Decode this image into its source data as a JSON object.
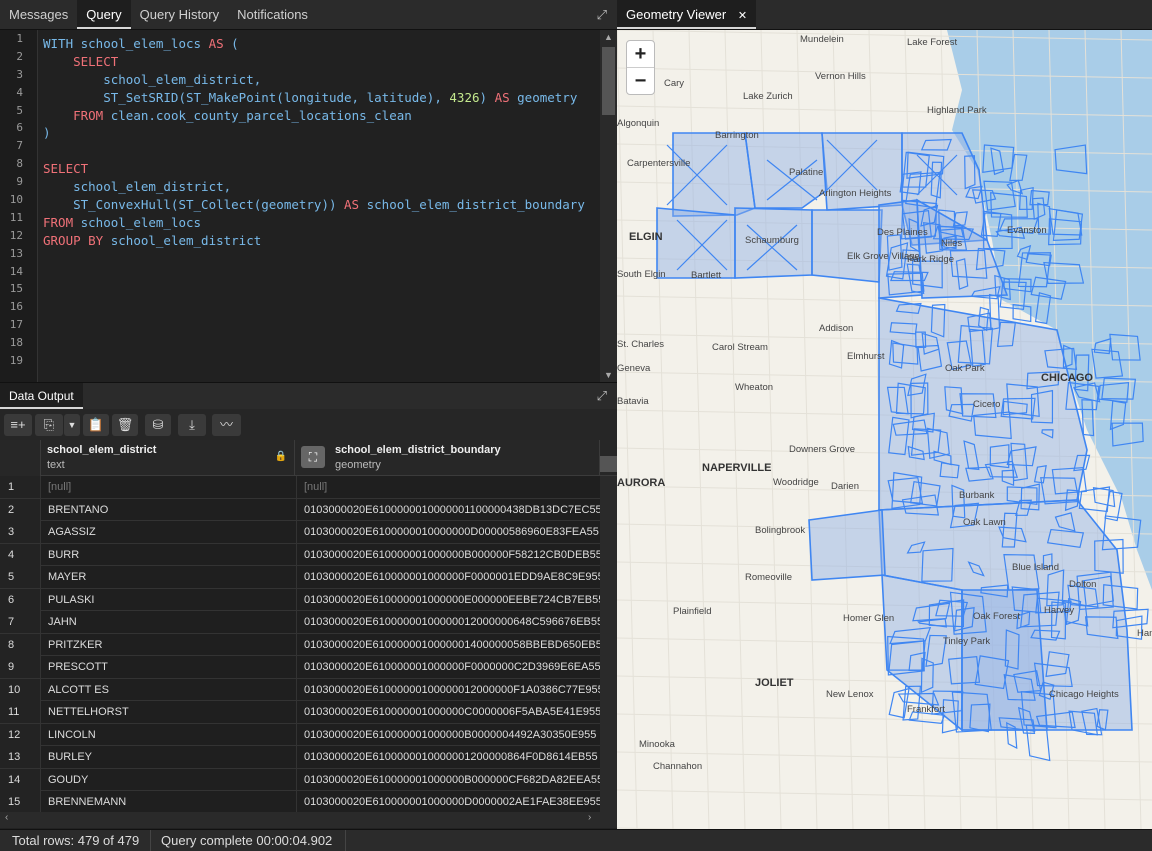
{
  "left_tabs": [
    "Messages",
    "Query",
    "Query History",
    "Notifications"
  ],
  "right_tab": {
    "label": "Geometry Viewer",
    "close": "✕"
  },
  "editor": {
    "line_numbers": [
      "1",
      "2",
      "3",
      "4",
      "5",
      "6",
      "7",
      "8",
      "9",
      "10",
      "11",
      "12",
      "13",
      "14",
      "15",
      "16",
      "17",
      "18",
      "19"
    ]
  },
  "output": {
    "title": "Data Output"
  },
  "grid": {
    "columns": [
      {
        "name": "school_elem_district",
        "type": "text"
      },
      {
        "name": "school_elem_district_boundary",
        "type": "geometry"
      }
    ],
    "rows": [
      {
        "n": "1",
        "district": "[null]",
        "geom": "[null]"
      },
      {
        "n": "2",
        "district": "BRENTANO",
        "geom": "0103000020E6100000010000001100000438DB13DC7EC55"
      },
      {
        "n": "3",
        "district": "AGASSIZ",
        "geom": "0103000020E6100000010000000D00000586960E83FEA55"
      },
      {
        "n": "4",
        "district": "BURR",
        "geom": "0103000020E610000001000000B000000F58212CB0DEB55"
      },
      {
        "n": "5",
        "district": "MAYER",
        "geom": "0103000020E610000001000000F0000001EDD9AE8C9E955"
      },
      {
        "n": "6",
        "district": "PULASKI",
        "geom": "0103000020E610000001000000E000000EEBE724CB7EB55"
      },
      {
        "n": "7",
        "district": "JAHN",
        "geom": "0103000020E61000000100000012000000648C596676EB55"
      },
      {
        "n": "8",
        "district": "PRITZKER",
        "geom": "0103000020E6100000010000001400000058BBEBD650EB55"
      },
      {
        "n": "9",
        "district": "PRESCOTT",
        "geom": "0103000020E610000001000000F0000000C2D3969E6EA55"
      },
      {
        "n": "10",
        "district": "ALCOTT ES",
        "geom": "0103000020E61000000100000012000000F1A0386C77E955"
      },
      {
        "n": "11",
        "district": "NETTELHORST",
        "geom": "0103000020E610000001000000C0000006F5ABA5E41E955"
      },
      {
        "n": "12",
        "district": "LINCOLN",
        "geom": "0103000020E610000001000000B0000004492A30350E955"
      },
      {
        "n": "13",
        "district": "BURLEY",
        "geom": "0103000020E6100000010000001200000864F0D8614EB55"
      },
      {
        "n": "14",
        "district": "GOUDY",
        "geom": "0103000020E610000001000000B000000CF682DA82EEA55"
      },
      {
        "n": "15",
        "district": "BRENNEMANN",
        "geom": "0103000020E610000001000000D0000002AE1FAE38EE955"
      }
    ]
  },
  "status": {
    "total": "Total rows: 479 of 479",
    "time": "Query complete 00:00:04.902"
  },
  "map": {
    "zoom_in": "+",
    "zoom_out": "−",
    "labels": [
      "Mundelein",
      "Lake Forest",
      "Cary",
      "Vernon Hills",
      "Lake Zurich",
      "Highland Park",
      "Algonquin",
      "Barrington",
      "Carpentersville",
      "Palatine",
      "Arlington Heights",
      "ELGIN",
      "Schaumburg",
      "Des Plaines",
      "Niles",
      "Evanston",
      "South Elgin",
      "Bartlett",
      "Elk Grove Village",
      "Park Ridge",
      "Addison",
      "St. Charles",
      "Carol Stream",
      "Elmhurst",
      "Oak Park",
      "Geneva",
      "Wheaton",
      "CHICAGO",
      "Batavia",
      "Cicero",
      "Downers Grove",
      "AURORA",
      "NAPERVILLE",
      "Woodridge",
      "Darien",
      "Burbank",
      "Oak Lawn",
      "Bolingbrook",
      "Romeoville",
      "Blue Island",
      "Dolton",
      "Plainfield",
      "Homer Glen",
      "Oak Forest",
      "Harvey",
      "Tinley Park",
      "Ham",
      "JOLIET",
      "New Lenox",
      "Frankfort",
      "Chicago Heights",
      "Minooka",
      "Channahon"
    ]
  }
}
